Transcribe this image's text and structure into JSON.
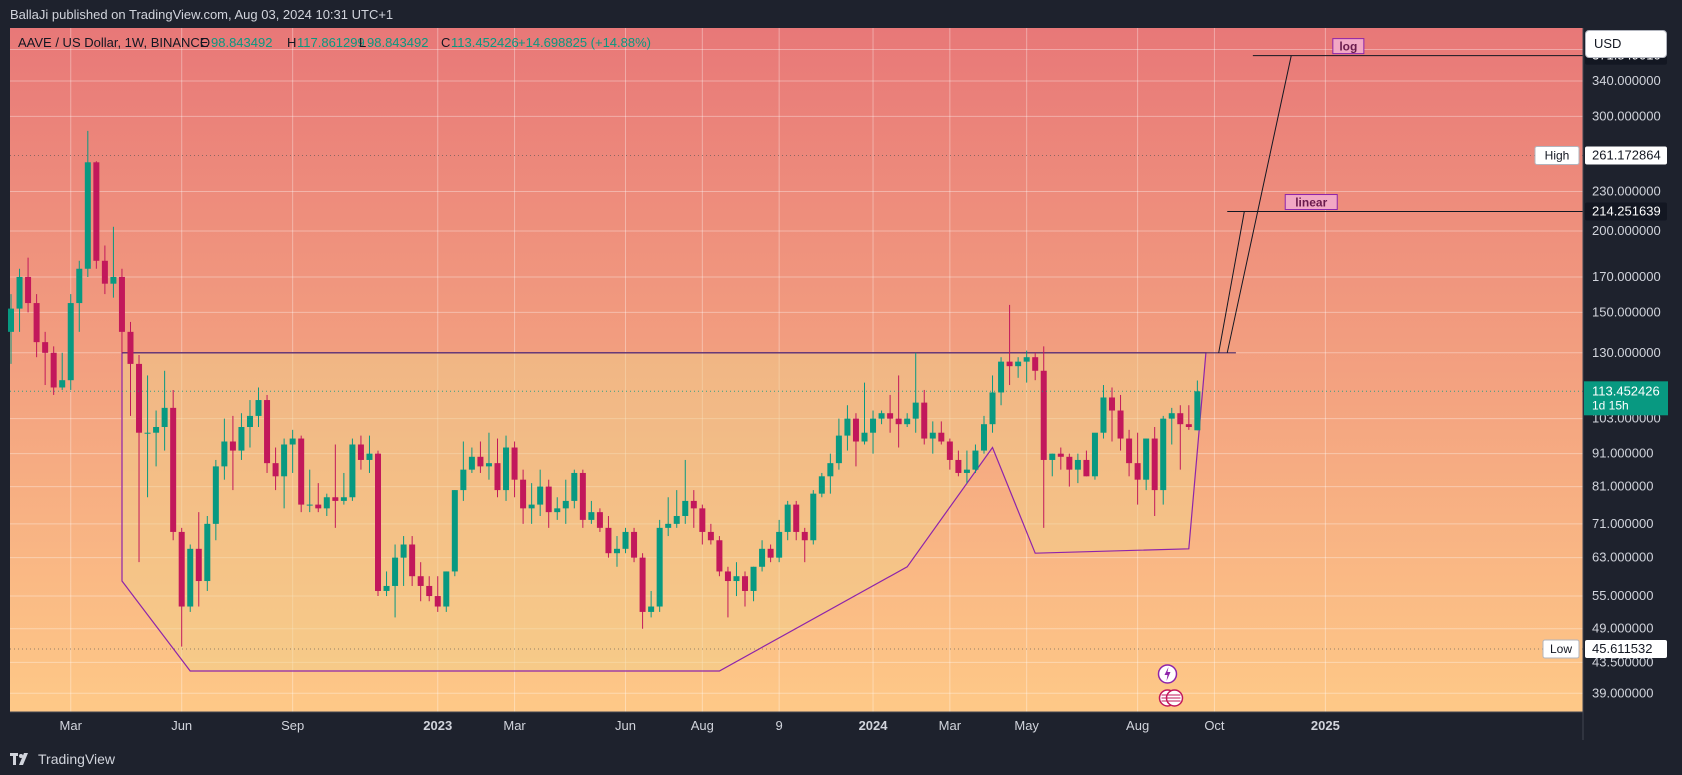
{
  "header": {
    "published": "BallaJi published on TradingView.com, Aug 03, 2024 10:31 UTC+1"
  },
  "legend": {
    "symbol": "AAVE / US Dollar, 1W, BINANCE",
    "o_label": "O",
    "o_value": "98.843492",
    "h_label": "H",
    "h_value": "117.861299",
    "l_label": "L",
    "l_value": "98.843492",
    "c_label": "C",
    "c_value": "113.452426",
    "change": "+14.698825 (+14.88%)"
  },
  "currency_button": {
    "label": "USD"
  },
  "footer": {
    "brand": "TradingView"
  },
  "colors": {
    "up": "#089981",
    "down": "#c2185b",
    "pattern": "#8e24aa",
    "price_tag": "#089981",
    "bg_top": "#e87878",
    "bg_bottom": "#ffcc88"
  },
  "chart_data": {
    "type": "candlestick",
    "y_scale": "log",
    "ylim": [
      36.5,
      410
    ],
    "y_ticks": [
      {
        "value": 39,
        "label": "39.000000"
      },
      {
        "value": 43.5,
        "label": "43.500000"
      },
      {
        "value": 49,
        "label": "49.000000"
      },
      {
        "value": 55,
        "label": "55.000000"
      },
      {
        "value": 63,
        "label": "63.000000"
      },
      {
        "value": 71,
        "label": "71.000000"
      },
      {
        "value": 81,
        "label": "81.000000"
      },
      {
        "value": 91,
        "label": "91.000000"
      },
      {
        "value": 103,
        "label": "103.000000"
      },
      {
        "value": 130,
        "label": "130.000000"
      },
      {
        "value": 150,
        "label": "150.000000"
      },
      {
        "value": 170,
        "label": "170.000000"
      },
      {
        "value": 200,
        "label": "200.000000"
      },
      {
        "value": 230,
        "label": "230.000000"
      },
      {
        "value": 300,
        "label": "300.000000"
      },
      {
        "value": 340,
        "label": "340.000000"
      },
      {
        "value": 380,
        "label": "380.000000"
      }
    ],
    "x_ticks": [
      {
        "label": "Mar",
        "week": 7,
        "bold": false
      },
      {
        "label": "Jun",
        "week": 20,
        "bold": false
      },
      {
        "label": "Sep",
        "week": 33,
        "bold": false
      },
      {
        "label": "2023",
        "week": 50,
        "bold": true
      },
      {
        "label": "Mar",
        "week": 59,
        "bold": false
      },
      {
        "label": "Jun",
        "week": 72,
        "bold": false
      },
      {
        "label": "Aug",
        "week": 81,
        "bold": false
      },
      {
        "label": "9",
        "week": 90,
        "bold": false
      },
      {
        "label": "2024",
        "week": 101,
        "bold": true
      },
      {
        "label": "Mar",
        "week": 110,
        "bold": false
      },
      {
        "label": "May",
        "week": 119,
        "bold": false
      },
      {
        "label": "Aug",
        "week": 132,
        "bold": false
      },
      {
        "label": "Oct",
        "week": 141,
        "bold": false
      },
      {
        "label": "2025",
        "week": 154,
        "bold": true
      }
    ],
    "candles": [
      [
        0,
        140,
        160,
        125,
        152
      ],
      [
        1,
        152,
        175,
        140,
        170
      ],
      [
        2,
        170,
        182,
        150,
        155
      ],
      [
        3,
        155,
        160,
        128,
        135
      ],
      [
        4,
        135,
        140,
        116,
        130
      ],
      [
        5,
        130,
        133,
        112,
        115
      ],
      [
        6,
        115,
        130,
        114,
        118
      ],
      [
        7,
        118,
        160,
        114,
        155
      ],
      [
        8,
        155,
        180,
        140,
        175
      ],
      [
        9,
        175,
        285,
        170,
        255
      ],
      [
        10,
        255,
        256,
        175,
        180
      ],
      [
        11,
        180,
        190,
        160,
        166
      ],
      [
        12,
        166,
        203,
        158,
        170
      ],
      [
        13,
        170,
        175,
        130,
        140
      ],
      [
        14,
        140,
        145,
        104,
        125
      ],
      [
        15,
        125,
        129,
        62,
        98
      ],
      [
        16,
        98,
        120,
        78,
        98
      ],
      [
        17,
        98,
        106,
        87,
        100
      ],
      [
        18,
        100,
        122,
        92,
        107
      ],
      [
        19,
        107,
        114,
        67,
        69
      ],
      [
        20,
        69,
        70,
        46,
        53
      ],
      [
        21,
        53,
        66,
        52,
        65
      ],
      [
        22,
        65,
        74,
        53,
        58
      ],
      [
        23,
        58,
        73,
        56,
        71
      ],
      [
        24,
        71,
        89,
        67,
        87
      ],
      [
        25,
        87,
        103,
        83,
        95
      ],
      [
        26,
        95,
        104,
        80,
        92
      ],
      [
        27,
        92,
        105,
        89,
        100
      ],
      [
        28,
        100,
        110,
        93,
        104
      ],
      [
        29,
        104,
        115,
        100,
        110
      ],
      [
        30,
        110,
        112,
        85,
        88
      ],
      [
        31,
        88,
        93,
        80,
        84
      ],
      [
        32,
        84,
        96,
        75,
        94
      ],
      [
        33,
        94,
        99,
        85,
        96
      ],
      [
        34,
        96,
        97,
        74,
        76
      ],
      [
        35,
        76,
        86,
        74,
        76
      ],
      [
        36,
        76,
        82,
        74,
        75
      ],
      [
        37,
        75,
        79,
        73,
        78
      ],
      [
        38,
        78,
        94,
        70,
        77
      ],
      [
        39,
        77,
        85,
        76,
        78
      ],
      [
        40,
        78,
        96,
        77,
        94
      ],
      [
        41,
        94,
        97,
        86,
        89
      ],
      [
        42,
        89,
        97,
        85,
        91
      ],
      [
        43,
        91,
        92,
        55,
        56
      ],
      [
        44,
        56,
        60,
        55,
        57
      ],
      [
        45,
        57,
        66,
        51,
        63
      ],
      [
        46,
        63,
        68,
        57,
        66
      ],
      [
        47,
        66,
        68,
        57,
        59
      ],
      [
        48,
        59,
        62,
        54,
        57
      ],
      [
        49,
        57,
        59,
        54,
        55
      ],
      [
        50,
        55,
        59,
        52,
        53
      ],
      [
        51,
        53,
        60,
        52,
        60
      ],
      [
        52,
        60,
        80,
        59,
        80
      ],
      [
        53,
        80,
        95,
        77,
        86
      ],
      [
        54,
        86,
        93,
        85,
        90
      ],
      [
        55,
        90,
        95,
        85,
        87
      ],
      [
        56,
        87,
        98,
        83,
        88
      ],
      [
        57,
        88,
        96,
        78,
        80
      ],
      [
        58,
        80,
        97,
        77,
        93
      ],
      [
        59,
        93,
        95,
        78,
        83
      ],
      [
        60,
        83,
        86,
        71,
        75
      ],
      [
        61,
        75,
        82,
        71,
        76
      ],
      [
        62,
        76,
        86,
        73,
        81
      ],
      [
        63,
        81,
        83,
        70,
        74
      ],
      [
        64,
        74,
        78,
        72,
        75
      ],
      [
        65,
        75,
        83,
        71,
        77
      ],
      [
        66,
        77,
        86,
        75,
        85
      ],
      [
        67,
        85,
        86,
        70,
        72
      ],
      [
        68,
        72,
        77,
        71,
        74
      ],
      [
        69,
        74,
        75,
        69,
        70
      ],
      [
        70,
        70,
        73,
        63,
        64
      ],
      [
        71,
        64,
        68,
        61,
        65
      ],
      [
        72,
        65,
        70,
        64,
        69
      ],
      [
        73,
        69,
        70,
        62,
        63
      ],
      [
        74,
        63,
        64,
        49,
        52
      ],
      [
        75,
        52,
        56,
        51,
        53
      ],
      [
        76,
        53,
        72,
        52,
        70
      ],
      [
        77,
        70,
        78,
        68,
        71
      ],
      [
        78,
        71,
        80,
        70,
        73
      ],
      [
        79,
        73,
        89,
        71,
        77
      ],
      [
        80,
        77,
        80,
        70,
        75
      ],
      [
        81,
        75,
        76,
        66,
        69
      ],
      [
        82,
        69,
        71,
        66,
        67
      ],
      [
        83,
        67,
        68,
        59,
        60
      ],
      [
        84,
        60,
        61,
        51,
        58
      ],
      [
        85,
        58,
        62,
        55,
        59
      ],
      [
        86,
        59,
        60,
        53,
        56
      ],
      [
        87,
        56,
        61,
        54,
        61
      ],
      [
        88,
        61,
        67,
        60,
        65
      ],
      [
        89,
        65,
        66,
        62,
        63
      ],
      [
        90,
        63,
        72,
        62,
        69
      ],
      [
        91,
        69,
        77,
        67,
        76
      ],
      [
        92,
        76,
        77,
        67,
        69
      ],
      [
        93,
        69,
        70,
        62,
        67
      ],
      [
        94,
        67,
        80,
        66,
        79
      ],
      [
        95,
        79,
        85,
        78,
        84
      ],
      [
        96,
        84,
        91,
        79,
        88
      ],
      [
        97,
        88,
        103,
        86,
        97
      ],
      [
        98,
        97,
        108,
        92,
        103
      ],
      [
        99,
        103,
        105,
        87,
        95
      ],
      [
        100,
        95,
        117,
        94,
        98
      ],
      [
        101,
        98,
        106,
        91,
        103
      ],
      [
        102,
        103,
        106,
        101,
        105
      ],
      [
        103,
        105,
        112,
        98,
        103
      ],
      [
        104,
        103,
        120,
        93,
        101
      ],
      [
        105,
        101,
        105,
        100,
        103
      ],
      [
        106,
        103,
        130,
        98,
        109
      ],
      [
        107,
        109,
        114,
        94,
        96
      ],
      [
        108,
        96,
        102,
        91,
        98
      ],
      [
        109,
        98,
        102,
        94,
        95
      ],
      [
        110,
        95,
        96,
        86,
        89
      ],
      [
        111,
        89,
        92,
        84,
        85
      ],
      [
        112,
        85,
        92,
        82,
        86
      ],
      [
        113,
        86,
        94,
        85,
        92
      ],
      [
        114,
        92,
        104,
        91,
        101
      ],
      [
        115,
        101,
        120,
        98,
        113
      ],
      [
        116,
        113,
        128,
        108,
        126
      ],
      [
        117,
        126,
        154,
        116,
        124
      ],
      [
        118,
        124,
        128,
        119,
        126
      ],
      [
        119,
        126,
        131,
        117,
        128
      ],
      [
        120,
        128,
        130,
        118,
        122
      ],
      [
        121,
        122,
        133,
        70,
        89
      ],
      [
        122,
        89,
        91,
        84,
        91
      ],
      [
        123,
        91,
        93,
        86,
        90
      ],
      [
        124,
        90,
        91,
        81,
        86
      ],
      [
        125,
        86,
        91,
        82,
        89
      ],
      [
        126,
        89,
        92,
        84,
        84
      ],
      [
        127,
        84,
        96,
        83,
        98
      ],
      [
        128,
        98,
        116,
        96,
        111
      ],
      [
        129,
        111,
        115,
        95,
        106
      ],
      [
        130,
        106,
        112,
        92,
        96
      ],
      [
        131,
        96,
        99,
        84,
        88
      ],
      [
        132,
        88,
        98,
        76,
        83
      ],
      [
        133,
        83,
        96,
        80,
        96
      ],
      [
        134,
        96,
        100,
        73,
        80
      ],
      [
        135,
        80,
        104,
        76,
        103
      ],
      [
        136,
        103,
        107,
        94,
        105
      ],
      [
        137,
        105,
        108,
        86,
        101
      ],
      [
        138,
        101,
        108,
        99,
        100
      ],
      [
        139,
        98.843492,
        117.861299,
        98.843492,
        113.452426
      ]
    ],
    "horizontal_lines": [
      {
        "value": 261.172864,
        "label": "High",
        "price": "261.172864",
        "style": "dotted"
      },
      {
        "value": 45.611532,
        "label": "Low",
        "price": "45.611532",
        "style": "dotted"
      },
      {
        "value": 113.452426,
        "style": "dotted-green"
      }
    ],
    "resistance_line": {
      "value": 130,
      "week_start": 13,
      "week_end": 140
    },
    "pattern_polygon": [
      [
        13,
        130
      ],
      [
        13,
        58
      ],
      [
        21,
        42.2
      ],
      [
        83,
        42.2
      ],
      [
        105,
        61
      ],
      [
        115,
        93
      ],
      [
        120,
        64
      ],
      [
        138,
        65
      ],
      [
        140,
        130
      ]
    ],
    "targets": [
      {
        "label": "linear",
        "price": "214.251639",
        "value": 214.251639,
        "line_start_week": 142.5,
        "path": [
          [
            141.5,
            130
          ],
          [
            144.5,
            214.251639
          ]
        ]
      },
      {
        "label": "log",
        "price": "371.849010",
        "value": 371.84901,
        "line_start_week": 145.5,
        "path": [
          [
            142.5,
            130
          ],
          [
            150,
            371.84901
          ]
        ]
      }
    ],
    "current_price": {
      "price": "113.452426",
      "countdown": "1d 15h"
    },
    "x_scale": {
      "week0_px": 11,
      "px_per_week": 8.535
    }
  }
}
